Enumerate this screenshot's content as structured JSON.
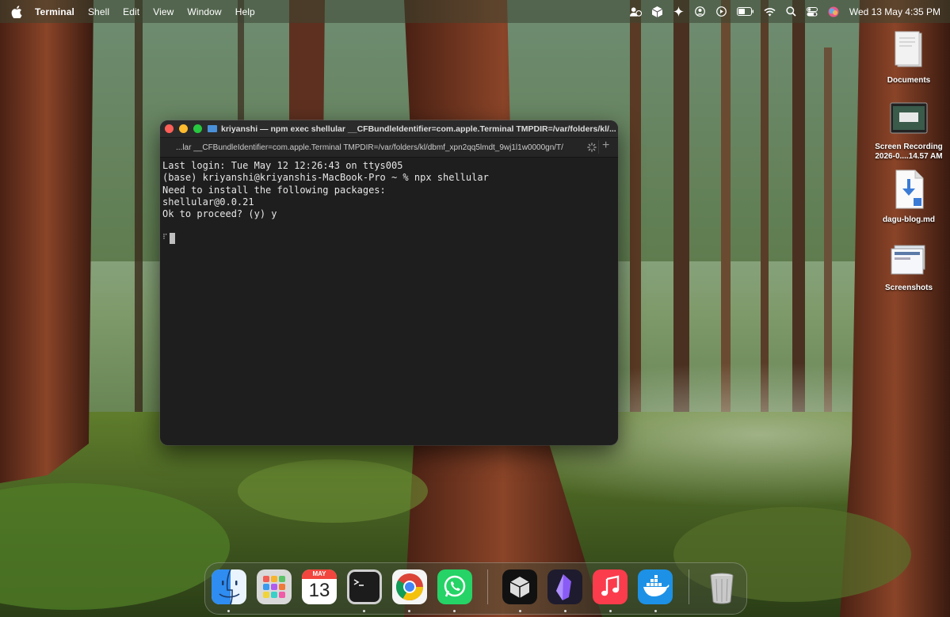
{
  "menubar": {
    "app_name": "Terminal",
    "menus": [
      "Shell",
      "Edit",
      "View",
      "Window",
      "Help"
    ],
    "clock": "Wed 13 May  4:35 PM"
  },
  "desktop": {
    "icons": [
      {
        "label": "Documents"
      },
      {
        "label": "Screen Recording 2026-0....14.57 AM"
      },
      {
        "label": "dagu-blog.md"
      },
      {
        "label": "Screenshots"
      }
    ]
  },
  "terminal": {
    "title": "kriyanshi — npm exec shellular __CFBundleIdentifier=com.apple.Terminal TMPDIR=/var/folders/kl/...",
    "tab_label": "...lar __CFBundleIdentifier=com.apple.Terminal TMPDIR=/var/folders/kl/dbmf_xpn2qq5lmdt_9wj1l1w0000gn/T/",
    "lines": [
      "Last login: Tue May 12 12:26:43 on ttys005",
      "(base) kriyanshi@kriyanshis-MacBook-Pro ~ % npx shellular",
      "Need to install the following packages:",
      "shellular@0.0.21",
      "Ok to proceed? (y) y"
    ]
  },
  "dock": {
    "apps": [
      {
        "name": "Finder",
        "icon": "finder-icon",
        "running": true
      },
      {
        "name": "Launchpad",
        "icon": "launchpad-icon",
        "running": false
      },
      {
        "name": "Calendar",
        "icon": "calendar-icon",
        "month": "MAY",
        "day": "13",
        "running": false
      },
      {
        "name": "Terminal",
        "icon": "terminal-icon",
        "running": true
      },
      {
        "name": "Google Chrome",
        "icon": "chrome-icon",
        "running": true
      },
      {
        "name": "WhatsApp",
        "icon": "whatsapp-icon",
        "running": true
      },
      {
        "name": "Cube app",
        "icon": "cube-icon",
        "running": true
      },
      {
        "name": "Obsidian",
        "icon": "obsidian-icon",
        "running": true
      },
      {
        "name": "Music",
        "icon": "music-icon",
        "running": true
      },
      {
        "name": "Docker",
        "icon": "docker-icon",
        "running": true
      },
      {
        "name": "Trash",
        "icon": "trash-icon",
        "running": false
      }
    ]
  }
}
